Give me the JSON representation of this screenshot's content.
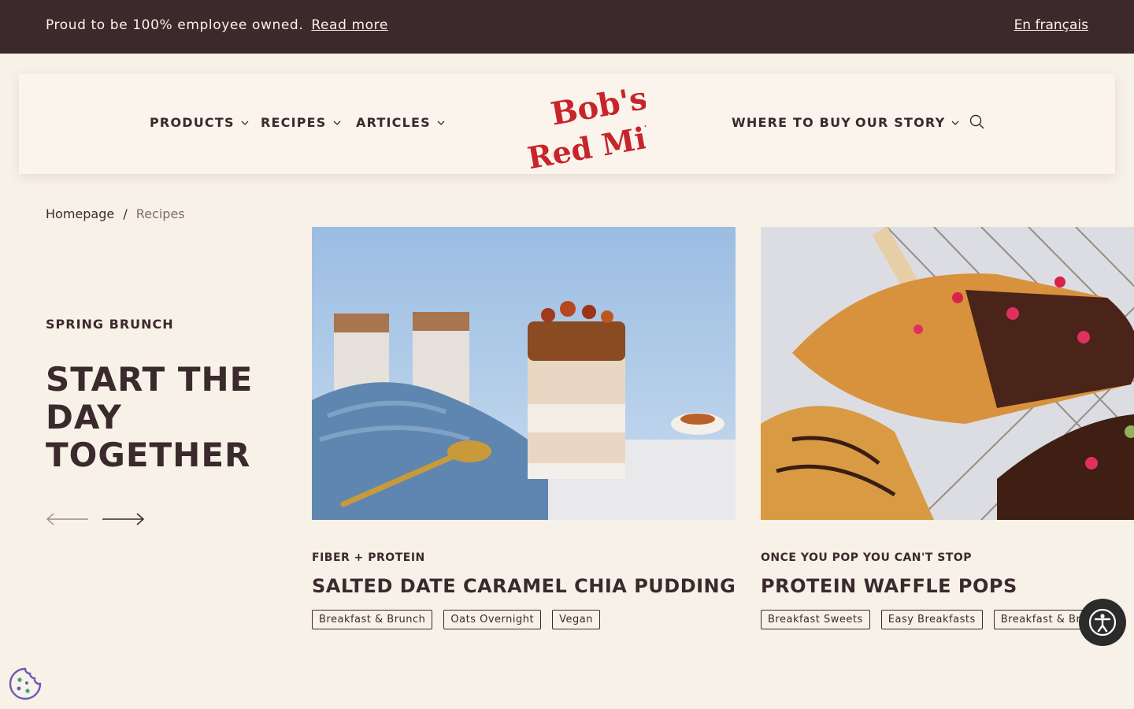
{
  "topbar": {
    "message": "Proud to be 100% employee owned.",
    "link": "Read more",
    "language": "En français"
  },
  "nav": {
    "left": [
      {
        "label": "PRODUCTS",
        "dropdown": true
      },
      {
        "label": "RECIPES",
        "dropdown": true
      },
      {
        "label": "ARTICLES",
        "dropdown": true
      }
    ],
    "right": [
      {
        "label": "WHERE TO BUY",
        "dropdown": false
      },
      {
        "label": "OUR STORY",
        "dropdown": true
      }
    ],
    "logo_line1": "Bob's",
    "logo_line2": "Red Mill",
    "icons": {
      "search": "search-icon",
      "chevron": "chevron-down-icon"
    }
  },
  "breadcrumb": {
    "home": "Homepage",
    "separator": "/",
    "current": "Recipes"
  },
  "hero": {
    "eyebrow": "SPRING BRUNCH",
    "headline": "START THE DAY TOGETHER",
    "icons": {
      "prev": "arrow-left-icon",
      "next": "arrow-right-icon"
    }
  },
  "cards": [
    {
      "kicker": "FIBER + PROTEIN",
      "title": "SALTED DATE CARAMEL CHIA PUDDING",
      "tags": [
        "Breakfast & Brunch",
        "Oats Overnight",
        "Vegan"
      ],
      "image": "chia-pudding-photo"
    },
    {
      "kicker": "ONCE YOU POP YOU CAN'T STOP",
      "title": "PROTEIN WAFFLE POPS",
      "tags": [
        "Breakfast Sweets",
        "Easy Breakfasts",
        "Breakfast & Brunch"
      ],
      "image": "waffle-pops-photo"
    }
  ],
  "floating": {
    "accessibility": "accessibility-icon",
    "cookie": "cookie-icon"
  },
  "colors": {
    "topbar": "#3c292b",
    "background": "#f8f1e8",
    "brand_red": "#c8242b",
    "text": "#3b2a2c"
  }
}
